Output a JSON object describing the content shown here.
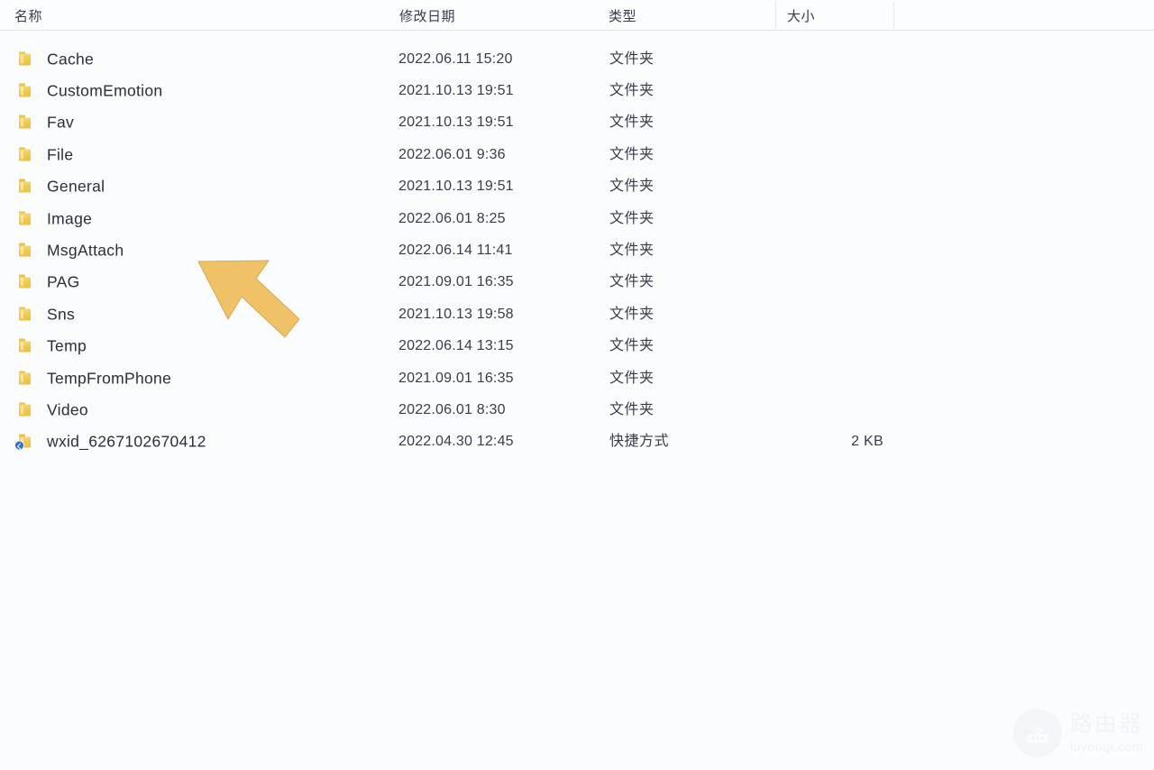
{
  "window": {
    "view": "file-list-details",
    "background_color": "#fbfcfe",
    "text_color": "#2d2d3c"
  },
  "columns": {
    "name": "名称",
    "date_modified": "修改日期",
    "type": "类型",
    "size": "大小"
  },
  "file_types": {
    "folder": "文件夹",
    "shortcut": "快捷方式"
  },
  "rows": [
    {
      "icon": "folder-icon",
      "name": "Cache",
      "date": "2022.06.11 15:20",
      "type": "文件夹",
      "size": ""
    },
    {
      "icon": "folder-icon",
      "name": "CustomEmotion",
      "date": "2021.10.13 19:51",
      "type": "文件夹",
      "size": ""
    },
    {
      "icon": "folder-icon",
      "name": "Fav",
      "date": "2021.10.13 19:51",
      "type": "文件夹",
      "size": ""
    },
    {
      "icon": "folder-icon",
      "name": "File",
      "date": "2022.06.01 9:36",
      "type": "文件夹",
      "size": ""
    },
    {
      "icon": "folder-icon",
      "name": "General",
      "date": "2021.10.13 19:51",
      "type": "文件夹",
      "size": ""
    },
    {
      "icon": "folder-icon",
      "name": "Image",
      "date": "2022.06.01 8:25",
      "type": "文件夹",
      "size": ""
    },
    {
      "icon": "folder-icon",
      "name": "MsgAttach",
      "date": "2022.06.14 11:41",
      "type": "文件夹",
      "size": ""
    },
    {
      "icon": "folder-icon",
      "name": "PAG",
      "date": "2021.09.01 16:35",
      "type": "文件夹",
      "size": ""
    },
    {
      "icon": "folder-icon",
      "name": "Sns",
      "date": "2021.10.13 19:58",
      "type": "文件夹",
      "size": ""
    },
    {
      "icon": "folder-icon",
      "name": "Temp",
      "date": "2022.06.14 13:15",
      "type": "文件夹",
      "size": ""
    },
    {
      "icon": "folder-icon",
      "name": "TempFromPhone",
      "date": "2021.09.01 16:35",
      "type": "文件夹",
      "size": ""
    },
    {
      "icon": "folder-icon",
      "name": "Video",
      "date": "2022.06.01 8:30",
      "type": "文件夹",
      "size": ""
    },
    {
      "icon": "shortcut-icon",
      "name": "wxid_6267102670412",
      "date": "2022.04.30 12:45",
      "type": "快捷方式",
      "size": "2 KB"
    }
  ],
  "annotation": {
    "arrow": {
      "name": "pointer-arrow",
      "color": "#f0c268",
      "direction": "up-left",
      "points_at": "MsgAttach"
    }
  },
  "watermark": {
    "icon": "router-icon",
    "title": "路由器",
    "subtitle": "luyouqi.com"
  }
}
